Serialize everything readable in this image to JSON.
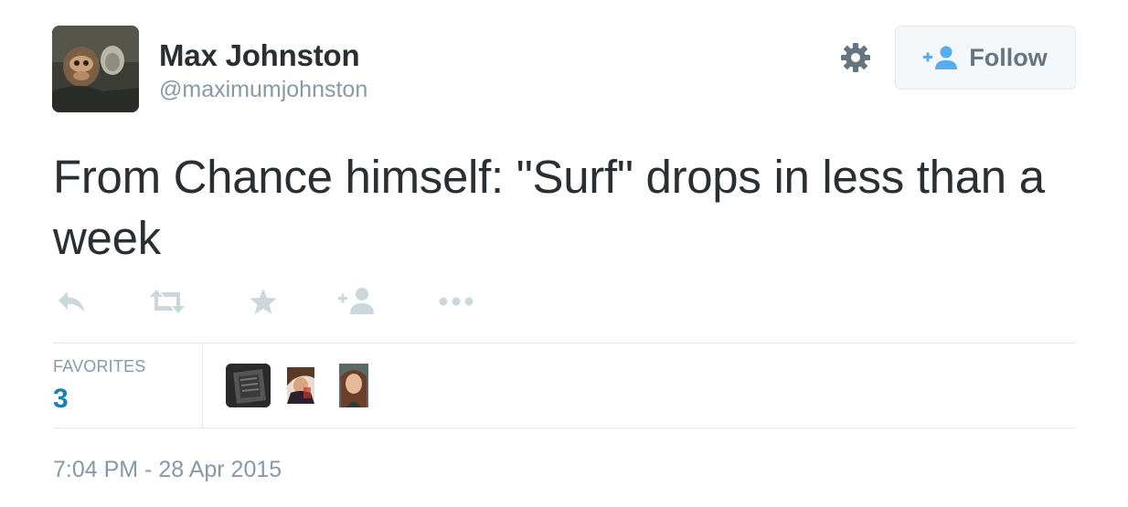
{
  "user": {
    "name": "Max Johnston",
    "handle": "@maximumjohnston",
    "avatar_icon": "avatar-photo"
  },
  "settings_icon": "gear-icon",
  "follow": {
    "label": "Follow",
    "icon": "add-person-icon"
  },
  "tweet": {
    "text": "From Chance himself: \"Surf\" drops in less than a week"
  },
  "actions": [
    {
      "name": "reply",
      "icon": "reply-icon"
    },
    {
      "name": "retweet",
      "icon": "retweet-icon"
    },
    {
      "name": "favorite",
      "icon": "star-icon"
    },
    {
      "name": "follow",
      "icon": "add-person-icon"
    },
    {
      "name": "more",
      "icon": "more-dots-icon"
    }
  ],
  "stats": {
    "label": "FAVORITES",
    "count": "3"
  },
  "favorited_by_count": 3,
  "timestamp": "7:04 PM - 28 Apr 2015",
  "colors": {
    "text": "#292f33",
    "secondary": "#8899a6",
    "count_blue": "#1a7fb1",
    "action_icon": "#ccd6dd",
    "follow_icon": "#55acee"
  }
}
